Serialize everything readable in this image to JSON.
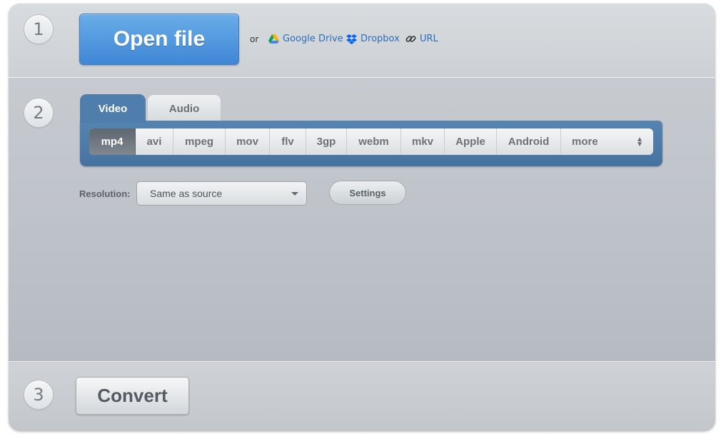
{
  "steps": [
    "1",
    "2",
    "3"
  ],
  "open": {
    "button_label": "Open file",
    "or_text": "or",
    "sources": [
      {
        "label": "Google Drive",
        "icon": "google-drive-icon"
      },
      {
        "label": "Dropbox",
        "icon": "dropbox-icon"
      },
      {
        "label": "URL",
        "icon": "link-icon"
      }
    ]
  },
  "tabs": [
    {
      "label": "Video",
      "active": true
    },
    {
      "label": "Audio",
      "active": false
    }
  ],
  "formats": [
    "mp4",
    "avi",
    "mpeg",
    "mov",
    "flv",
    "3gp",
    "webm",
    "mkv",
    "Apple",
    "Android",
    "more"
  ],
  "selected_format": "mp4",
  "resolution": {
    "label": "Resolution:",
    "value": "Same as source"
  },
  "settings_label": "Settings",
  "convert_label": "Convert",
  "colors": {
    "open_button": "#4a90dc",
    "tab_active": "#4f7eac",
    "link": "#2a6ebd"
  }
}
